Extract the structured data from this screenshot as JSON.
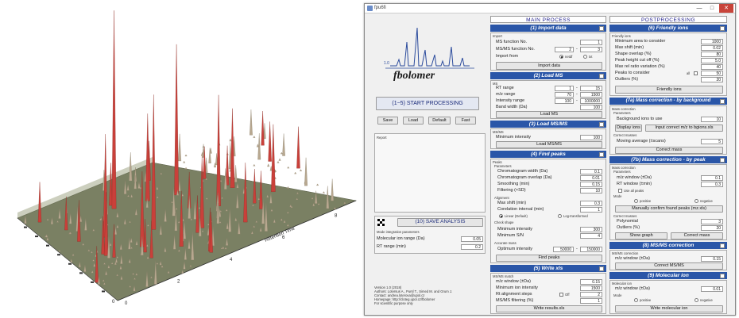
{
  "window": {
    "title": "fpu6fi",
    "min": "—",
    "max": "□",
    "close": "✕"
  },
  "logo": {
    "text": "fbolomer",
    "superscript": "1.0"
  },
  "left": {
    "start_button": "(1−5) START PROCESSING",
    "save": "Save",
    "load": "Load",
    "default": "Default",
    "fast": "Fast",
    "report_label": "Report",
    "save_analysis": "(10) SAVE ANALYSIS",
    "peak_params_label": "Mode integration parameters",
    "mol_ion_range_label": "Molecular ion range (Da)",
    "mol_ion_range": "0.05",
    "rt_range_label": "RT range (min)",
    "rt_range": "0.2",
    "footer": [
      "Version 1.0 (2018)",
      "Authors: Lotersus A., Pursl T., Simed M. and Grum J.",
      "Contact: andrea.loterova@upol.cz",
      "Homepage: http://cloteg.upol.cz/fbolomer",
      "For scientific purpose only"
    ]
  },
  "main": {
    "title": "MAIN PROCESS",
    "s1": {
      "title": "(1) Import data",
      "group": "Import",
      "ms_label": "MS function No.",
      "ms": "1",
      "msms_label": "MS/MS function No.",
      "msms_a": "2",
      "msms_b": "3",
      "import_from": "Import from",
      "netcdf": "netdf",
      "txt": "txt",
      "button": "Import data"
    },
    "s2": {
      "title": "(2) Load MS",
      "group": "MS",
      "rt_label": "RT range",
      "rt_a": "1",
      "rt_b": "15",
      "mz_label": "m/z range",
      "mz_a": "70",
      "mz_b": "1500",
      "int_label": "Intensity range",
      "int_a": "100",
      "int_b": "1000000",
      "band_label": "Band width (Da)",
      "band": "100",
      "button": "Load MS"
    },
    "s3": {
      "title": "(3) Load MS/MS",
      "group": "MS/MS",
      "min_label": "Minimum intensity",
      "min": "100",
      "button": "Load MS/MS"
    },
    "s4": {
      "title": "(4) Find peaks",
      "group": "Peaks",
      "params": "Parameters",
      "cw_label": "Chromatogram width (Da)",
      "cw": "0.1",
      "co_label": "Chromatogram overlap (Da)",
      "co": "0.01",
      "sm_label": "Smoothing (min)",
      "sm": "0.15",
      "fi_label": "Filtering (×SD)",
      "fi": "10",
      "align": "Alignment",
      "maxs_label": "Max shift (min)",
      "maxs": "0.3",
      "corr_label": "Corelation interval (min)",
      "corr": "1",
      "linear": "Linear (Default)",
      "log": "Log-transformed",
      "check": "Check shape",
      "mint_label": "Minimum intensity",
      "mint": "300",
      "msn_label": "Minimum S/N",
      "msn": "4",
      "acc": "Accurate mass",
      "opt_label": "Optimum intensity",
      "opt_a": "50000",
      "opt_b": "150000",
      "button": "Find peaks"
    },
    "s5": {
      "title": "(5) Write xls",
      "group": "MS/MS match",
      "mzw_label": "m/z window (±Da)",
      "mzw": "0.15",
      "mii_label": "Minimum ion intensity",
      "mii": "1500",
      "rt_label": "Rt alignment steps",
      "off": "Off",
      "rt": "2",
      "fil_label": "MS/MS filtering (%)",
      "fil": "1",
      "button": "Write results.xls"
    }
  },
  "post": {
    "title": "POSTPROCESSING",
    "s6": {
      "title": "(6) Friendly ions",
      "group": "Friendly ions",
      "a_label": "Minimum area to consider",
      "a": "1000",
      "b_label": "Max shift (min)",
      "b": "0.02",
      "c_label": "Shape overlap (%)",
      "c": "80",
      "d_label": "Peak height cut off (%)",
      "d": "5.0",
      "e_label": "Max rel ratio variation (%)",
      "e": "40",
      "f_label": "Peaks to consider",
      "all": "all",
      "f": "50",
      "g_label": "Outliers (%)",
      "g": "20",
      "button": "Friendly ions"
    },
    "s7a": {
      "title": "(7a) Mass correction - by background",
      "group": "Mass correction",
      "params": "Parameters",
      "bg_label": "Background ions to use",
      "bg": "10",
      "display": "Display ions",
      "input": "Input correct m/z to bgions.xls",
      "corr": "Correct masses",
      "mov_label": "Moving average (±scans)",
      "mov": "5",
      "button": "Correct mass"
    },
    "s7b": {
      "title": "(7b) Mass correction - by peak",
      "group": "Mass correction",
      "params": "Parameters",
      "mzw_label": "m/z window (±Da)",
      "mzw": "0.1",
      "rtw_label": "RT window (±min)",
      "rtw": "0.3",
      "useall": "Use all peaks",
      "mode": "Mode",
      "pos": "positive",
      "neg": "negative",
      "manual": "Manually confirm found peaks (mz.xls)",
      "corr": "Correct masses",
      "poly_label": "Polynomial",
      "poly": "3",
      "out_label": "Outliers (%)",
      "out": "20",
      "show": "Show graph",
      "button": "Correct mass"
    },
    "s8": {
      "title": "(8) MS/MS correction",
      "group": "MS/MS correction",
      "mzw_label": "m/z window (±Da)",
      "mzw": "0.15",
      "button": "Correct MS/MS"
    },
    "s9": {
      "title": "(9) Molecular ion",
      "group": "Molecular ion",
      "mzw_label": "m/z window (±Da)",
      "mzw": "0.01",
      "mode": "Mode",
      "pos": "positive",
      "neg": "negative",
      "button": "Write molecular ion"
    }
  },
  "plot": {
    "axis_label": "Retention Time",
    "ticks_x": [
      "0",
      "2",
      "4",
      "6",
      "8"
    ],
    "origin": "0"
  }
}
